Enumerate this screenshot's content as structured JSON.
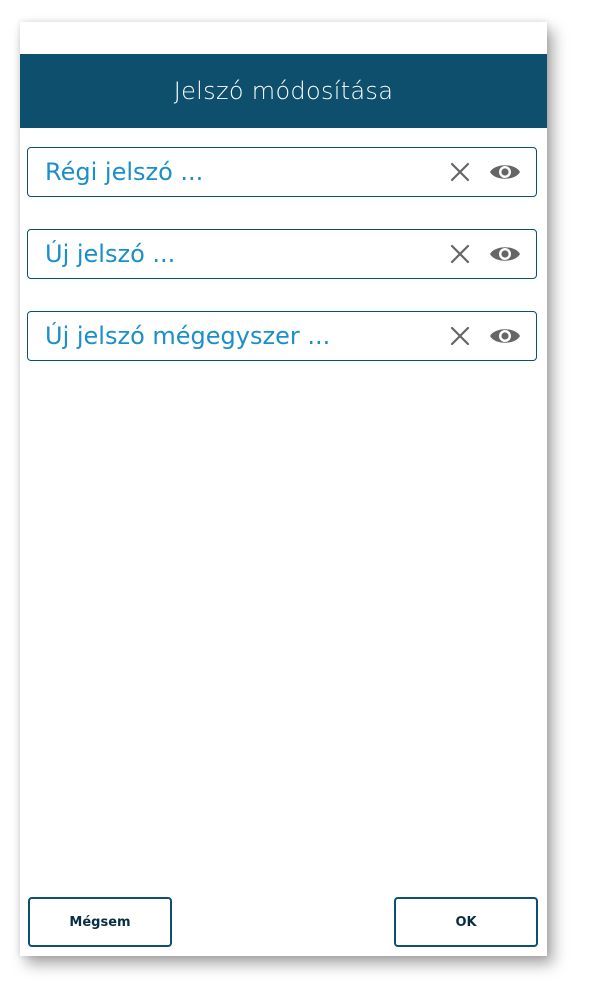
{
  "dialog": {
    "title": "Jelszó módosítása"
  },
  "fields": [
    {
      "placeholder": "Régi jelszó ...",
      "value": "",
      "clear_icon": "close-icon",
      "visibility_icon": "eye-icon"
    },
    {
      "placeholder": "Új jelszó ...",
      "value": "",
      "clear_icon": "close-icon",
      "visibility_icon": "eye-icon"
    },
    {
      "placeholder": "Új jelszó mégegyszer ...",
      "value": "",
      "clear_icon": "close-icon",
      "visibility_icon": "eye-icon"
    }
  ],
  "buttons": {
    "cancel_label": "Mégsem",
    "ok_label": "OK"
  },
  "colors": {
    "header_bg": "#0d4f6c",
    "placeholder_text": "#1b8fc9",
    "border": "#0d4f6c",
    "icon": "#666666"
  }
}
